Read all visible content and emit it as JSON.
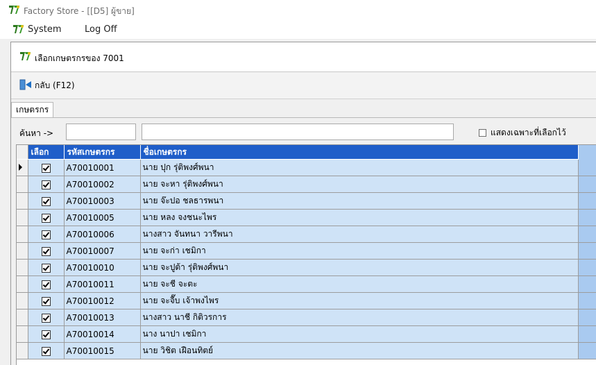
{
  "window": {
    "title": "Factory Store - [[D5] ผู้ขาย]"
  },
  "menu": {
    "system": "System",
    "logoff": "Log Off"
  },
  "form": {
    "title": "เลือกเกษตรกรของ 7001"
  },
  "toolbar": {
    "back_label": "กลับ (F12)"
  },
  "tabs": [
    {
      "label": "เกษตรกร"
    }
  ],
  "search": {
    "label": "ค้นหา ->",
    "field1_value": "",
    "field2_value": "",
    "show_selected_label": "แสดงเฉพาะที่เลือกไว้",
    "show_selected_checked": false
  },
  "grid": {
    "columns": [
      "เลือก",
      "รหัสเกษตรกร",
      "ชื่อเกษตรกร"
    ],
    "rows": [
      {
        "selected": true,
        "code": "A70010001",
        "name": "นาย ปุก รุ่ติพงศ์พนา",
        "current": true
      },
      {
        "selected": true,
        "code": "A70010002",
        "name": "นาย จะหา รุ่ติพงศ์พนา"
      },
      {
        "selected": true,
        "code": "A70010003",
        "name": "นาย จ๊ะปอ ชลธารพนา"
      },
      {
        "selected": true,
        "code": "A70010005",
        "name": "นาย หลง จงชนะไพร"
      },
      {
        "selected": true,
        "code": "A70010006",
        "name": "นางสาว จันทนา วารีพนา"
      },
      {
        "selected": true,
        "code": "A70010007",
        "name": "นาย จะก่า เชมิกา"
      },
      {
        "selected": true,
        "code": "A70010010",
        "name": "นาย จะปูต้า รุ่ติพงศ์พนา"
      },
      {
        "selected": true,
        "code": "A70010011",
        "name": "นาย จะชี จะตะ"
      },
      {
        "selected": true,
        "code": "A70010012",
        "name": "นาย จะจื๊บ เจ้าพงไพร"
      },
      {
        "selected": true,
        "code": "A70010013",
        "name": "นางสาว นาชี กิติวรการ"
      },
      {
        "selected": true,
        "code": "A70010014",
        "name": "นาง นาปา เชมิกา"
      },
      {
        "selected": true,
        "code": "A70010015",
        "name": "นาย วิชิต เฝือนทิตย์"
      }
    ]
  },
  "icons": {
    "app": "app-logo-icon",
    "back": "back-arrow-icon",
    "row_pointer": "row-pointer-icon"
  },
  "colors": {
    "header_bg": "#1f5ec9",
    "row_bg": "#cfe3f7",
    "empty_area": "#a9caf0"
  }
}
